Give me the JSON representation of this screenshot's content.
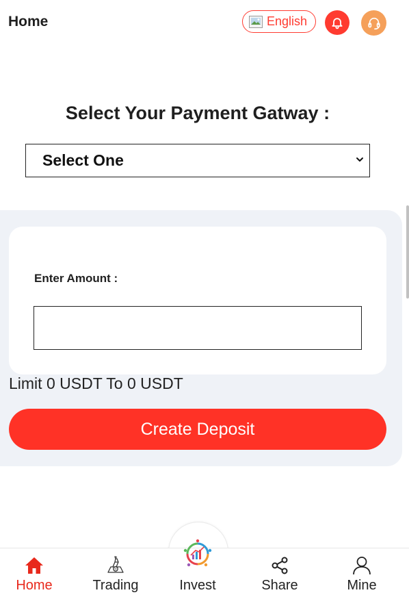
{
  "header": {
    "title": "Home",
    "language_label": "English",
    "icons": {
      "flag": "broken-image-icon",
      "bell": "bell-icon",
      "support": "headset-icon"
    },
    "colors": {
      "accent": "#ff3b30",
      "support": "#f5a05a"
    }
  },
  "main": {
    "gateway_heading": "Select Your Payment Gatway :",
    "gateway_select_value": "Select One",
    "amount_label": "Enter Amount :",
    "amount_value": "",
    "limit_text": "Limit 0 USDT To 0 USDT",
    "deposit_button": "Create Deposit",
    "colors": {
      "panel_bg": "#eff2f7",
      "button": "#ff3226"
    }
  },
  "bottom_nav": {
    "items": [
      {
        "label": "Home",
        "icon": "home-icon",
        "active": true
      },
      {
        "label": "Trading",
        "icon": "trading-icon",
        "active": false
      },
      {
        "label": "Invest",
        "icon": "invest-icon",
        "active": false
      },
      {
        "label": "Share",
        "icon": "share-icon",
        "active": false
      },
      {
        "label": "Mine",
        "icon": "user-icon",
        "active": false
      }
    ],
    "colors": {
      "active": "#e8291c",
      "inactive": "#222222"
    }
  }
}
